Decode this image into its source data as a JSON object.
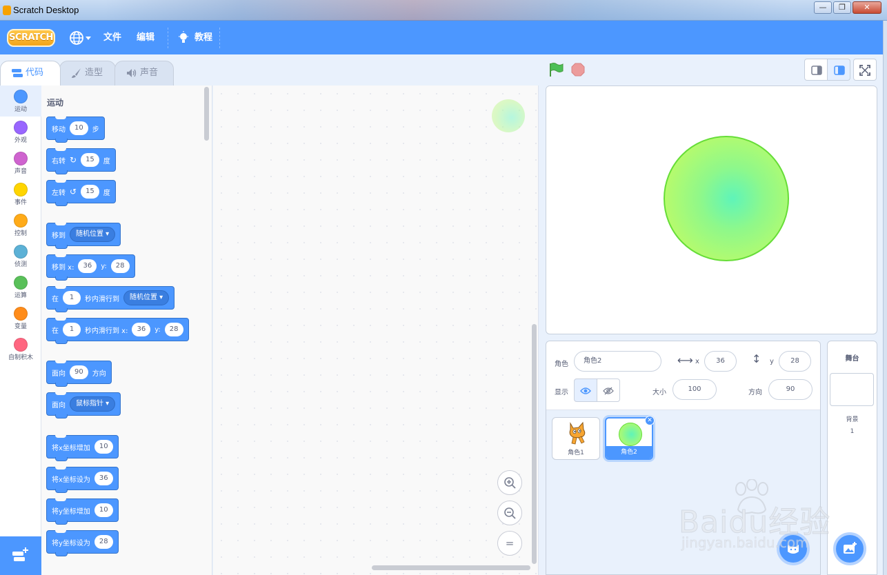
{
  "window": {
    "title": "Scratch Desktop",
    "buttons": [
      "—",
      "❐",
      "✕"
    ]
  },
  "menubar": {
    "logo": "SCRATCH",
    "file": "文件",
    "edit": "编辑",
    "tutorials": "教程"
  },
  "tabs": [
    {
      "label": "代码",
      "active": true
    },
    {
      "label": "造型",
      "active": false
    },
    {
      "label": "声音",
      "active": false
    }
  ],
  "categories": [
    {
      "label": "运动",
      "color": "#4c97ff"
    },
    {
      "label": "外观",
      "color": "#9966ff"
    },
    {
      "label": "声音",
      "color": "#cf63cf"
    },
    {
      "label": "事件",
      "color": "#ffd500"
    },
    {
      "label": "控制",
      "color": "#ffab19"
    },
    {
      "label": "侦测",
      "color": "#5cb1d6"
    },
    {
      "label": "运算",
      "color": "#59c059"
    },
    {
      "label": "变量",
      "color": "#ff8c1a"
    },
    {
      "label": "自制积木",
      "color": "#ff6680"
    }
  ],
  "palette": {
    "section_title": "运动",
    "blocks": {
      "move": {
        "a": "移动",
        "v": "10",
        "b": "步"
      },
      "turn_right": {
        "a": "右转",
        "v": "15",
        "b": "度"
      },
      "turn_left": {
        "a": "左转",
        "v": "15",
        "b": "度"
      },
      "goto": {
        "a": "移到",
        "menu": "随机位置"
      },
      "goto_xy": {
        "a": "移到 x:",
        "x": "36",
        "yl": "y:",
        "y": "28"
      },
      "glide": {
        "a": "在",
        "v": "1",
        "b": "秒内滑行到",
        "menu": "随机位置"
      },
      "glide_xy": {
        "a": "在",
        "v": "1",
        "b": "秒内滑行到 x:",
        "x": "36",
        "yl": "y:",
        "y": "28"
      },
      "point_dir": {
        "a": "面向",
        "v": "90",
        "b": "方向"
      },
      "point_towards": {
        "a": "面向",
        "menu": "鼠标指针"
      },
      "change_x": {
        "a": "将x坐标增加",
        "v": "10"
      },
      "set_x": {
        "a": "将x坐标设为",
        "v": "36"
      },
      "change_y": {
        "a": "将y坐标增加",
        "v": "10"
      },
      "set_y": {
        "a": "将y坐标设为",
        "v": "28"
      }
    }
  },
  "zoom": {
    "in": "+",
    "out": "−",
    "reset": "="
  },
  "sprite_info": {
    "sprite_label": "角色",
    "sprite_name": "角色2",
    "x_label": "x",
    "x": "36",
    "y_label": "y",
    "y": "28",
    "show_label": "显示",
    "size_label": "大小",
    "size": "100",
    "direction_label": "方向",
    "direction": "90"
  },
  "sprites": [
    {
      "name": "角色1",
      "selected": false
    },
    {
      "name": "角色2",
      "selected": true
    }
  ],
  "stage_pane": {
    "title": "舞台",
    "backdrops_label": "背景",
    "backdrops_count": "1"
  },
  "watermark": {
    "logo": "Baidu经验",
    "url": "jingyan.baidu.com"
  },
  "colors": {
    "accent": "#4c97ff",
    "menubar": "#4c97ff",
    "green_flag": "#4cbf56",
    "stop": "#ec9c9c"
  }
}
